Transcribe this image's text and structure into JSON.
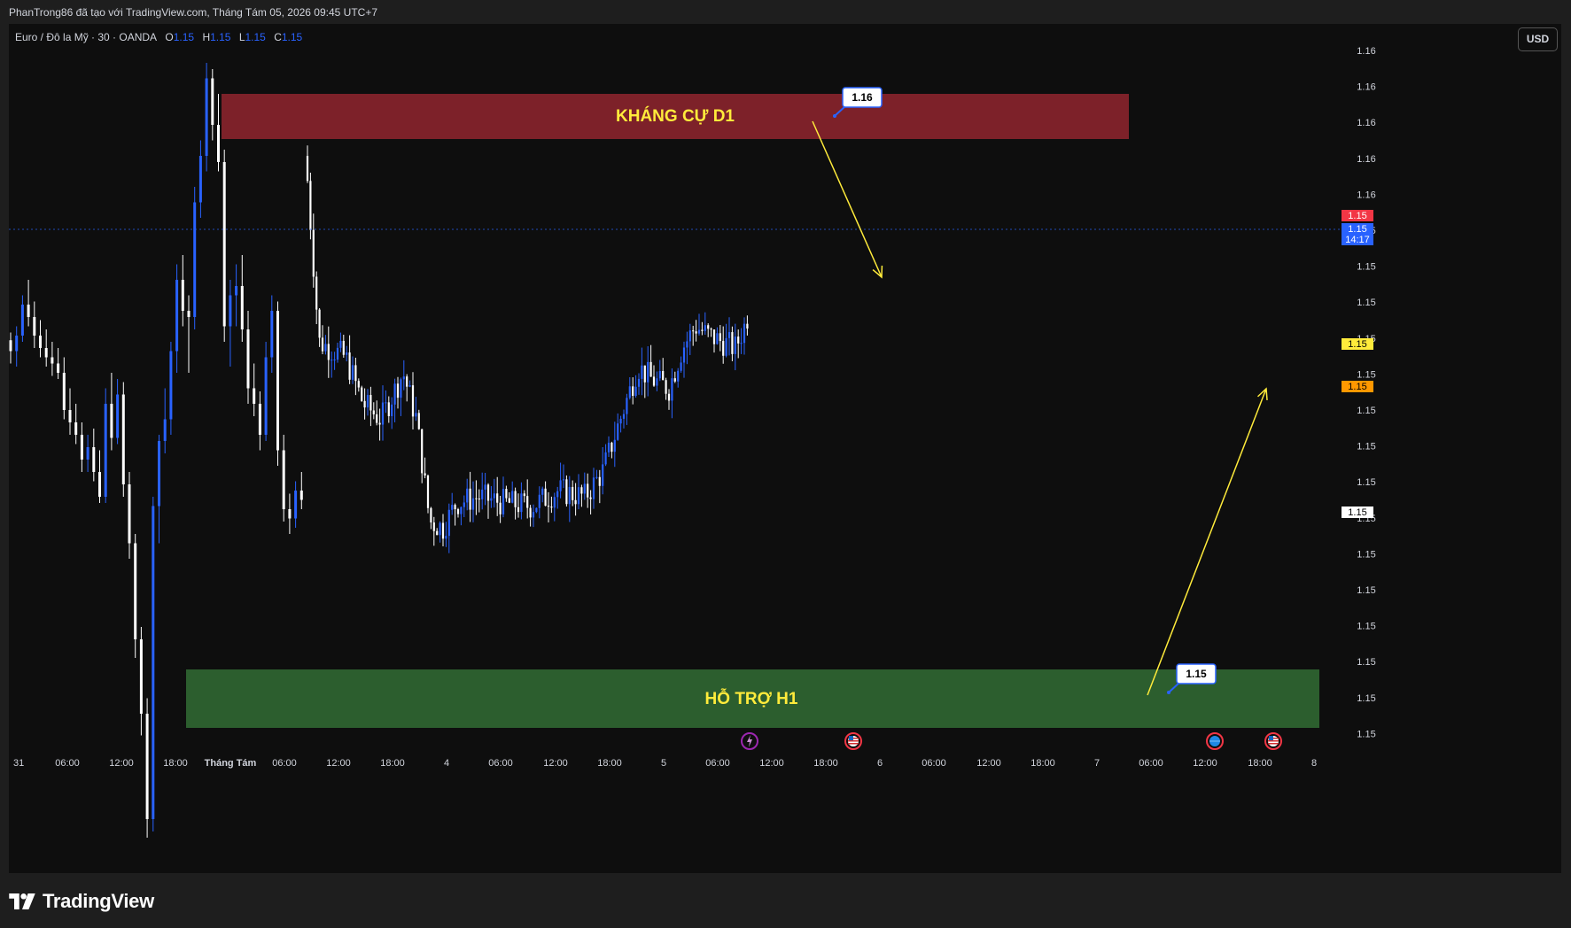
{
  "header": {
    "credit": "PhanTrong86 đã tạo với TradingView.com, Tháng Tám 05, 2026 09:45 UTC+7"
  },
  "symbol": {
    "name": "Euro / Đô la Mỹ · 30 · OANDA",
    "o_label": "O",
    "o_value": "1.15",
    "h_label": "H",
    "h_value": "1.15",
    "l_label": "L",
    "l_value": "1.15",
    "c_label": "C",
    "c_value": "1.15"
  },
  "toolbar": {
    "currency": "USD"
  },
  "footer": {
    "brand": "TradingView"
  },
  "colors": {
    "background": "#0e0e0e",
    "up_candle": "#2962ff",
    "down_candle": "#ffffff",
    "resistance_zone": "#7d2129",
    "support_zone": "#2c5e2e",
    "zone_label": "#ffeb3b",
    "arrow": "#ffeb3b",
    "last_price": "#2962ff",
    "marker_red": "#f23645",
    "marker_yellow": "#ffeb3b",
    "marker_orange": "#ff9800"
  },
  "chart_data": {
    "type": "candlestick",
    "price_scale_labels": [
      "1.16",
      "1.16",
      "1.16",
      "1.16",
      "1.16",
      "1.15",
      "1.15",
      "1.15",
      "1.15",
      "1.15",
      "1.15",
      "1.15",
      "1.15",
      "1.15",
      "1.15",
      "1.15",
      "1.15",
      "1.15",
      "1.15",
      "1.15"
    ],
    "price_tags": [
      {
        "text": "1.15",
        "color": "#f23645"
      },
      {
        "text": "1.15",
        "color": "#2962ff"
      },
      {
        "text": "14:17",
        "color": "#2962ff"
      },
      {
        "text": "1.15",
        "color": "#ffeb3b"
      },
      {
        "text": "1.15",
        "color": "#ff9800"
      },
      {
        "text": "1.15",
        "color": "#ffffff"
      }
    ],
    "time_labels": [
      "31",
      "06:00",
      "12:00",
      "18:00",
      "Tháng Tám",
      "06:00",
      "12:00",
      "18:00",
      "4",
      "06:00",
      "12:00",
      "18:00",
      "5",
      "06:00",
      "12:00",
      "18:00",
      "6",
      "06:00",
      "12:00",
      "18:00",
      "7",
      "06:00",
      "12:00",
      "18:00",
      "8"
    ],
    "zones": [
      {
        "label": "KHÁNG CỰ D1",
        "kind": "resistance"
      },
      {
        "label": "HỖ TRỢ H1",
        "kind": "support"
      }
    ],
    "callouts": [
      {
        "text": "1.16",
        "zone": "resistance"
      },
      {
        "text": "1.15",
        "zone": "support"
      }
    ],
    "events": [
      "lightning-icon",
      "us-flag-icon",
      "globe-icon",
      "us-flag-icon"
    ],
    "arrows": [
      {
        "direction": "down",
        "color": "#ffeb3b"
      },
      {
        "direction": "up",
        "color": "#ffeb3b"
      }
    ],
    "candles": [
      [
        1.15205,
        1.1523,
        1.1513,
        1.1517
      ],
      [
        1.1517,
        1.1525,
        1.1512,
        1.1522
      ],
      [
        1.1522,
        1.1535,
        1.152,
        1.1532
      ],
      [
        1.1532,
        1.154,
        1.1525,
        1.1528
      ],
      [
        1.1528,
        1.1533,
        1.1518,
        1.1522
      ],
      [
        1.1522,
        1.1527,
        1.1515,
        1.1518
      ],
      [
        1.1518,
        1.1524,
        1.1512,
        1.1515
      ],
      [
        1.1515,
        1.152,
        1.1509,
        1.1513
      ],
      [
        1.1513,
        1.1518,
        1.1508,
        1.151
      ],
      [
        1.151,
        1.1515,
        1.1495,
        1.1498
      ],
      [
        1.1498,
        1.1505,
        1.149,
        1.1494
      ],
      [
        1.1494,
        1.15,
        1.1487,
        1.149
      ],
      [
        1.149,
        1.1494,
        1.1478,
        1.1482
      ],
      [
        1.1482,
        1.149,
        1.1478,
        1.1486
      ],
      [
        1.1486,
        1.1492,
        1.1475,
        1.1478
      ],
      [
        1.1478,
        1.1485,
        1.1468,
        1.147
      ],
      [
        1.147,
        1.1505,
        1.1468,
        1.15
      ],
      [
        1.15,
        1.151,
        1.1485,
        1.1489
      ],
      [
        1.1489,
        1.1508,
        1.1487,
        1.1503
      ],
      [
        1.1503,
        1.1507,
        1.147,
        1.1474
      ],
      [
        1.1474,
        1.1478,
        1.145,
        1.1455
      ],
      [
        1.1455,
        1.1458,
        1.1418,
        1.1424
      ],
      [
        1.1424,
        1.1428,
        1.1393,
        1.14
      ],
      [
        1.14,
        1.1405,
        1.136,
        1.1366
      ],
      [
        1.1366,
        1.147,
        1.1362,
        1.1467
      ],
      [
        1.1467,
        1.149,
        1.1455,
        1.1488
      ],
      [
        1.1488,
        1.1505,
        1.1484,
        1.1495
      ],
      [
        1.1495,
        1.152,
        1.149,
        1.1517
      ],
      [
        1.1517,
        1.1545,
        1.151,
        1.154
      ],
      [
        1.154,
        1.1548,
        1.1525,
        1.153
      ],
      [
        1.153,
        1.1535,
        1.151,
        1.1528
      ],
      [
        1.1528,
        1.157,
        1.1524,
        1.1565
      ],
      [
        1.1565,
        1.1585,
        1.156,
        1.158
      ],
      [
        1.158,
        1.161,
        1.1575,
        1.1605
      ],
      [
        1.1605,
        1.1608,
        1.1585,
        1.159
      ],
      [
        1.159,
        1.16,
        1.1575,
        1.1578
      ],
      [
        1.1578,
        1.1582,
        1.152,
        1.1525
      ],
      [
        1.1525,
        1.154,
        1.1512,
        1.1535
      ],
      [
        1.1535,
        1.1545,
        1.1525,
        1.1538
      ],
      [
        1.1538,
        1.1548,
        1.152,
        1.1524
      ],
      [
        1.1524,
        1.153,
        1.15,
        1.1505
      ],
      [
        1.1505,
        1.1513,
        1.1496,
        1.15
      ],
      [
        1.15,
        1.1504,
        1.1485,
        1.149
      ],
      [
        1.149,
        1.152,
        1.1488,
        1.1515
      ],
      [
        1.1515,
        1.1535,
        1.151,
        1.153
      ],
      [
        1.153,
        1.1533,
        1.148,
        1.1485
      ],
      [
        1.1485,
        1.149,
        1.1462,
        1.1466
      ],
      [
        1.1466,
        1.1471,
        1.1458,
        1.1463
      ],
      [
        1.1463,
        1.1475,
        1.146,
        1.1472
      ],
      [
        1.1472,
        1.1478,
        1.1466,
        1.1469
      ],
      [
        1.1469,
        1.1475,
        1.1462,
        1.147
      ],
      [
        1.147,
        1.1478,
        1.1464,
        1.1467
      ],
      [
        1.1467,
        1.1472,
        1.146,
        1.1465
      ],
      [
        1.1465,
        1.147,
        1.1457,
        1.1462
      ],
      [
        1.1462,
        1.1474,
        1.1459,
        1.1471
      ],
      [
        1.1471,
        1.1476,
        1.1464,
        1.1468
      ],
      [
        1.1468,
        1.1475,
        1.1463,
        1.1472
      ],
      [
        1.1472,
        1.148,
        1.1468,
        1.1477
      ],
      [
        1.1477,
        1.1481,
        1.1469,
        1.1472
      ],
      [
        1.1472,
        1.148,
        1.1469,
        1.1478
      ],
      [
        1.1478,
        1.151,
        1.1475,
        1.1506
      ],
      [
        1.1506,
        1.152,
        1.15,
        1.1516
      ],
      [
        1.1516,
        1.1525,
        1.1505,
        1.151
      ],
      [
        1.151,
        1.1515,
        1.1496,
        1.15
      ],
      [
        1.15,
        1.1512,
        1.1495,
        1.1508
      ],
      [
        1.1508,
        1.1522,
        1.1502,
        1.1518
      ],
      [
        1.1518,
        1.1521,
        1.1505,
        1.151
      ],
      [
        1.151,
        1.1515,
        1.15,
        1.1505
      ],
      [
        1.1505,
        1.1514,
        1.15,
        1.1511
      ]
    ]
  }
}
